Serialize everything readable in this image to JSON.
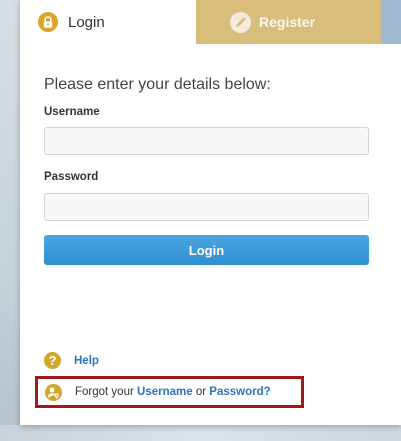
{
  "tabs": {
    "login_label": "Login",
    "register_label": "Register"
  },
  "form": {
    "intro": "Please enter your details below:",
    "username_label": "Username",
    "username_value": "",
    "password_label": "Password",
    "password_value": "",
    "submit_label": "Login"
  },
  "help": {
    "label": "Help"
  },
  "forgot": {
    "prefix": "Forgot your",
    "username_link": "Username",
    "conjunction": "or",
    "password_link": "Password?"
  },
  "colors": {
    "register_tab": "#d8bd7c",
    "login_button": "#3a9ad8",
    "link": "#2b74c2",
    "highlight_border": "#9b1b1b",
    "icon_gold": "#d3a62d"
  },
  "icons": {
    "login_tab": "lock-icon",
    "register_tab": "pencil-icon",
    "help": "question-icon",
    "forgot": "user-key-icon"
  }
}
